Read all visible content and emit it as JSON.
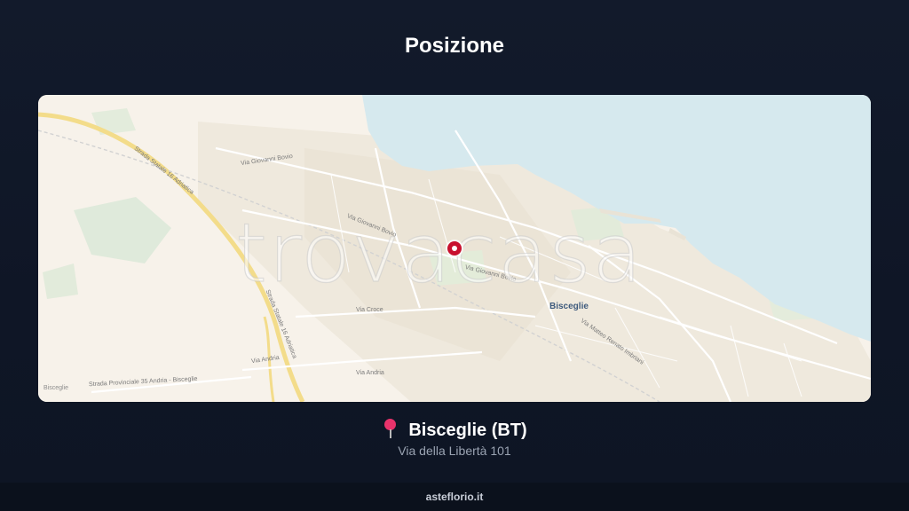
{
  "header": {
    "title": "Posizione"
  },
  "map": {
    "watermark": "trovacasa",
    "city_label": "Bisceglie",
    "street_labels": {
      "via_giovanni_bovio_1": "Via Giovanni Bovio",
      "via_giovanni_bovio_2": "Via Giovanni Bovio",
      "via_giovanni_bovio_3": "Via Giovanni Bovio",
      "statale_16_1": "Strada Statale 16 Adriatica",
      "statale_16_2": "Strada Statale 16 Adriatica",
      "via_croce": "Via Croce",
      "via_andria_1": "Via Andria",
      "via_andria_2": "Via Andria",
      "provinciale": "Strada Provinciale 35 Andria - Bisceglie",
      "bisceglie_small": "Bisceglie",
      "via_matteo_renato": "Via Matteo Renato Imbriani"
    },
    "colors": {
      "sea": "#d6e9ee",
      "land": "#f7f2ea",
      "marker": "#c8102e",
      "highway": "#f3dc8a"
    }
  },
  "location": {
    "city": "Bisceglie (BT)",
    "address": "Via della Libertà 101",
    "icon": "map-pin-icon"
  },
  "footer": {
    "site": "asteflorio.it"
  }
}
